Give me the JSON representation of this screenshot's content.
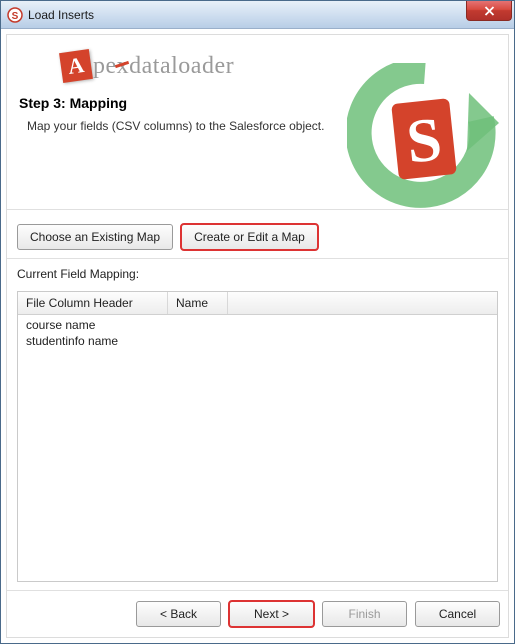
{
  "window": {
    "title": "Load Inserts"
  },
  "logo": {
    "badge_letter": "A",
    "text_pe": "pe",
    "text_x": "x",
    "text_rest": "dataloader"
  },
  "header": {
    "step_title": "Step 3: Mapping",
    "step_desc": "Map your fields (CSV columns) to the Salesforce object."
  },
  "buttons": {
    "choose_map": "Choose an Existing Map",
    "create_map": "Create or Edit a Map"
  },
  "mapping": {
    "label": "Current Field Mapping:",
    "columns": {
      "file_header": "File Column Header",
      "name": "Name"
    },
    "rows": [
      {
        "file": "course name",
        "name": ""
      },
      {
        "file": "studentinfo name",
        "name": ""
      }
    ]
  },
  "footer": {
    "back": "< Back",
    "next": "Next >",
    "finish": "Finish",
    "cancel": "Cancel"
  }
}
